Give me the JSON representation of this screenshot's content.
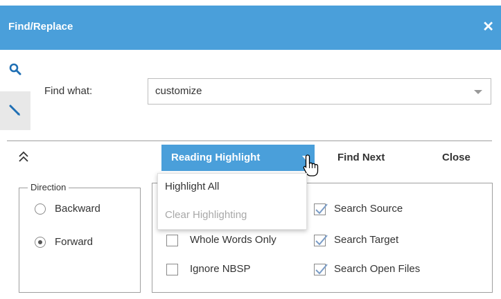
{
  "dialog": {
    "title": "Find/Replace",
    "close_icon": "close-icon"
  },
  "sidebar": {
    "items": [
      {
        "icon": "search-icon",
        "name": "find"
      },
      {
        "icon": "pencil-icon",
        "name": "replace",
        "active": true
      }
    ]
  },
  "find": {
    "label": "Find what:",
    "value": "customize"
  },
  "toolbar": {
    "split_label": "Reading Highlight",
    "find_next": "Find Next",
    "close": "Close"
  },
  "menu": {
    "items": [
      {
        "label": "Highlight All",
        "enabled": true
      },
      {
        "label": "Clear Highlighting",
        "enabled": false
      }
    ]
  },
  "direction": {
    "legend": "Direction",
    "options": [
      {
        "label": "Backward",
        "selected": false
      },
      {
        "label": "Forward",
        "selected": true
      }
    ]
  },
  "options": {
    "left": [
      {
        "label": "Whole Words Only",
        "checked": false
      },
      {
        "label": "Ignore NBSP",
        "checked": false
      }
    ],
    "right": [
      {
        "label": "Search Source",
        "checked": true
      },
      {
        "label": "Search Target",
        "checked": true
      },
      {
        "label": "Search Open Files",
        "checked": true
      }
    ]
  },
  "colors": {
    "accent": "#4a9fda",
    "check": "#7a9cc6"
  }
}
